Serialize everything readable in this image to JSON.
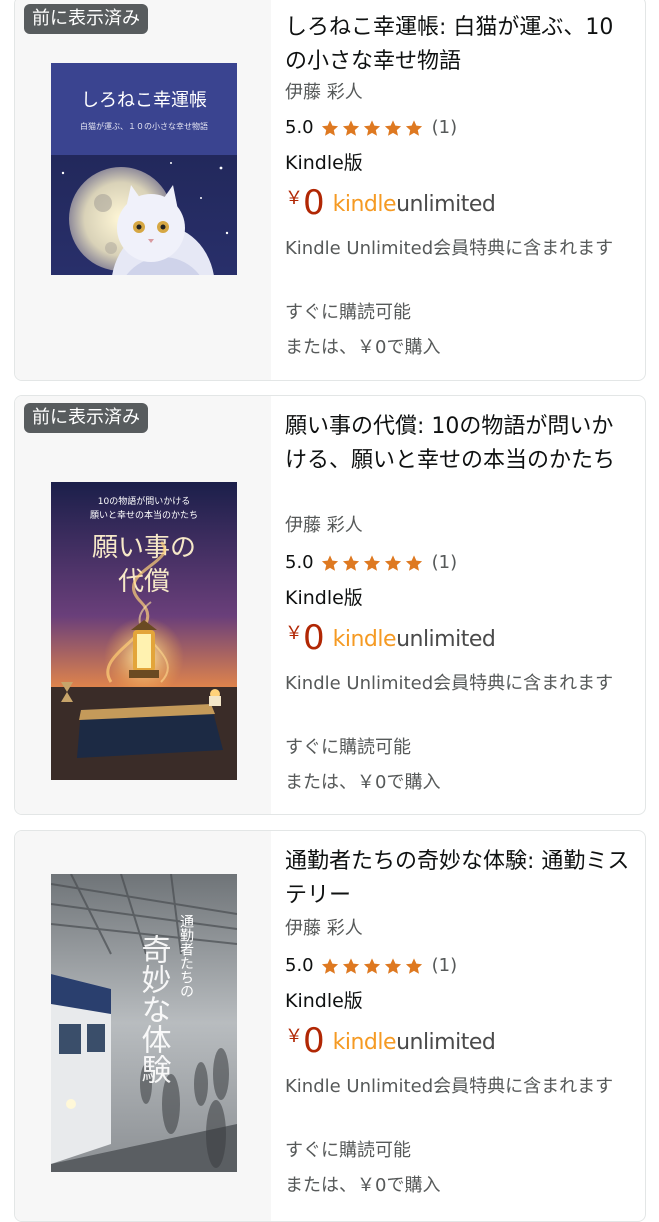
{
  "colors": {
    "price": "#b12704",
    "star": "#de7921",
    "badge": "#585c5e",
    "ku_orange": "#f59a23"
  },
  "books": [
    {
      "badge": "前に表示済み",
      "cover_title": "しろねこ幸運帳",
      "cover_subtitle": "白猫が運ぶ、１０の小さな幸せ物語",
      "title": "しろねこ幸運帳: 白猫が運ぶ、10の小さな幸せ物語",
      "author": "伊藤 彩人",
      "rating": "5.0",
      "rating_value": 5,
      "review_count": "(1)",
      "format": "Kindle版",
      "price_symbol": "￥",
      "price": "0",
      "ku_kindle": "kindle",
      "ku_unlimited": "unlimited",
      "ku_note": "Kindle Unlimited会員特典に含まれます",
      "availability": "すぐに購読可能",
      "alt_price": "または、￥0で購入"
    },
    {
      "badge": "前に表示済み",
      "cover_title_line1": "10の物語が問いかける",
      "cover_title_line2": "願いと幸せの本当のかたち",
      "cover_main_1": "願い事の",
      "cover_main_2": "代償",
      "title": "願い事の代償: 10の物語が問いかける、願いと幸せの本当のかたち",
      "author": "伊藤 彩人",
      "rating": "5.0",
      "rating_value": 5,
      "review_count": "(1)",
      "format": "Kindle版",
      "price_symbol": "￥",
      "price": "0",
      "ku_kindle": "kindle",
      "ku_unlimited": "unlimited",
      "ku_note": "Kindle Unlimited会員特典に含まれます",
      "availability": "すぐに購読可能",
      "alt_price": "または、￥0で購入"
    },
    {
      "cover_small": "通勤者たちの",
      "cover_big": "奇妙な体験",
      "title": "通勤者たちの奇妙な体験: 通勤ミステリー",
      "author": "伊藤 彩人",
      "rating": "5.0",
      "rating_value": 5,
      "review_count": "(1)",
      "format": "Kindle版",
      "price_symbol": "￥",
      "price": "0",
      "ku_kindle": "kindle",
      "ku_unlimited": "unlimited",
      "ku_note": "Kindle Unlimited会員特典に含まれます",
      "availability": "すぐに購読可能",
      "alt_price": "または、￥0で購入"
    }
  ]
}
